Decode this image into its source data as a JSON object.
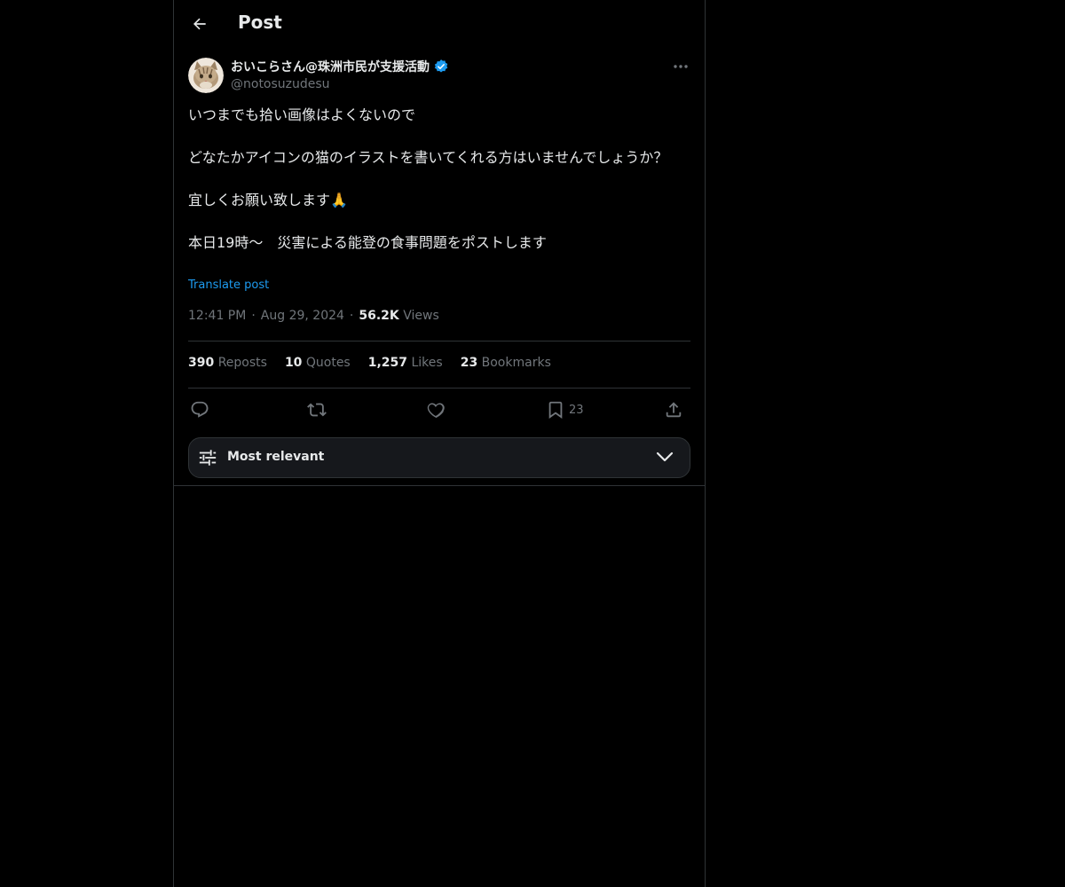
{
  "header": {
    "title": "Post"
  },
  "author": {
    "display_name": "おいこらさん@珠洲市民が支援活動",
    "handle": "@notosuzudesu",
    "verified": true
  },
  "tweet": {
    "lines": [
      "いつまでも拾い画像はよくないので",
      "どなたかアイコンの猫のイラストを書いてくれる方はいませんでしょうか？",
      "宜しくお願い致します🙏",
      "本日19時〜　災害による能登の食事問題をポストします"
    ],
    "translate_label": "Translate post"
  },
  "meta": {
    "time": "12:41 PM",
    "separator": "·",
    "date": "Aug 29, 2024",
    "views_count": "56.2K",
    "views_label": "Views"
  },
  "stats": {
    "reposts": {
      "count": "390",
      "label": "Reposts"
    },
    "quotes": {
      "count": "10",
      "label": "Quotes"
    },
    "likes": {
      "count": "1,257",
      "label": "Likes"
    },
    "bookmarks": {
      "count": "23",
      "label": "Bookmarks"
    }
  },
  "actions": {
    "reply_icon": "reply-icon",
    "repost_icon": "repost-icon",
    "like_icon": "heart-icon",
    "bookmark_icon": "bookmark-icon",
    "bookmark_count": "23",
    "share_icon": "share-icon"
  },
  "sort": {
    "label": "Most relevant"
  },
  "colors": {
    "background": "#000000",
    "text": "#e7e9ea",
    "secondary": "#71767b",
    "accent": "#1d9bf0",
    "border": "#2f3336"
  }
}
